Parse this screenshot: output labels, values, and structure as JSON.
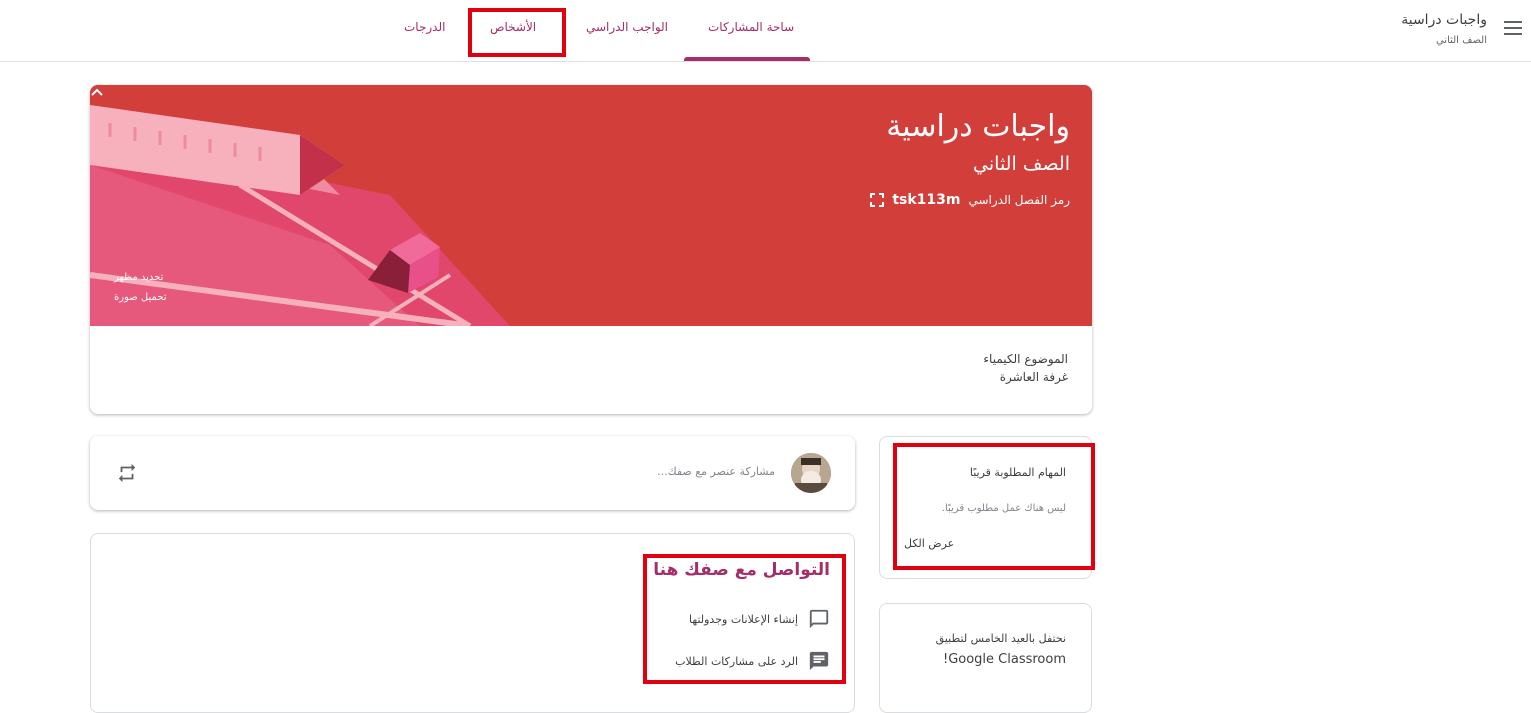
{
  "header": {
    "class_title": "واجبات دراسية",
    "class_subtitle": "الصف الثاني",
    "tabs": [
      {
        "label": "ساحة المشاركات",
        "active": true
      },
      {
        "label": "الواجب الدراسي",
        "active": false
      },
      {
        "label": "الأشخاص",
        "active": false
      },
      {
        "label": "الدرجات",
        "active": false
      }
    ]
  },
  "banner": {
    "title": "واجبات دراسية",
    "subtitle": "الصف الثاني",
    "class_code_label": "رمز الفصل الدراسي",
    "class_code": "tsk113m",
    "select_theme": "تحديد مظهر",
    "upload_photo": "تحميل صورة",
    "color": "#d23f3b"
  },
  "details": {
    "subject": "الموضوع الكيمياء",
    "room": "غرفة العاشرة"
  },
  "share": {
    "placeholder": "مشاركة عنصر مع صفك..."
  },
  "communicate": {
    "title": "التواصل مع صفك هنا",
    "items": [
      {
        "label": "إنشاء الإعلانات وجدولتها",
        "icon": "comment-outline-icon"
      },
      {
        "label": "الرد على مشاركات الطلاب",
        "icon": "comment-filled-icon"
      }
    ]
  },
  "upcoming": {
    "title": "المهام المطلوبة قريبًا",
    "empty": "ليس هناك عمل مطلوب قريبًا.",
    "view_all": "عرض الكل"
  },
  "celebrate": {
    "line1": "نحتفل بالعيد الخامس لتطبيق",
    "line2": "Google Classroom!"
  },
  "colors": {
    "accent": "#a52d6a",
    "highlight": "#e0000f",
    "banner": "#d23f3b"
  }
}
